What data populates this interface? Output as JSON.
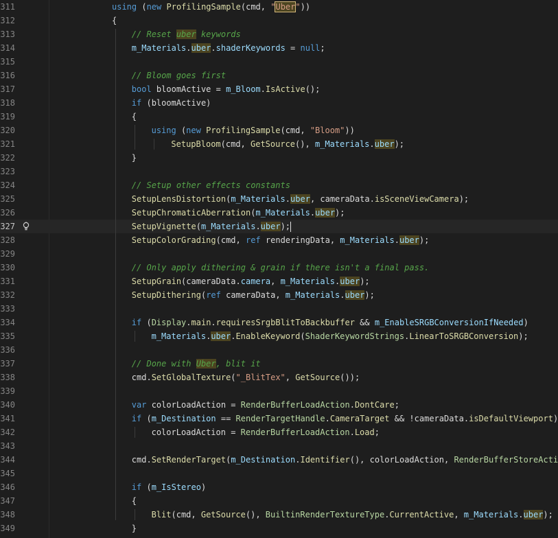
{
  "editor": {
    "current_line_number": "327",
    "search_highlight": "uber",
    "colors": {
      "background": "#1e1e1e",
      "keyword": "#569cd6",
      "type": "#4ec9b0",
      "method": "#dcdcaa",
      "string": "#d69d85",
      "comment": "#57a64a",
      "default": "#dcdcdc",
      "line_number": "#858585",
      "match_highlight": "#4c4420"
    },
    "lines": [
      {
        "n": "311",
        "indent": 0,
        "t": [
          [
            "k",
            "using"
          ],
          [
            "p",
            " ("
          ],
          [
            "k",
            "new"
          ],
          [
            "p",
            " "
          ],
          [
            "m",
            "ProfilingSample"
          ],
          [
            "p",
            "(cmd, "
          ],
          [
            "s",
            "\""
          ],
          [
            "sB",
            "Uber"
          ],
          [
            "s",
            "\""
          ],
          [
            "p",
            "))"
          ]
        ]
      },
      {
        "n": "312",
        "indent": 0,
        "t": [
          [
            "p",
            "{"
          ]
        ]
      },
      {
        "n": "313",
        "indent": 1,
        "t": [
          [
            "c",
            "// Reset "
          ],
          [
            "cH",
            "uber"
          ],
          [
            "c",
            " keywords"
          ]
        ]
      },
      {
        "n": "314",
        "indent": 1,
        "t": [
          [
            "f",
            "m_Materials"
          ],
          [
            "p",
            "."
          ],
          [
            "fH",
            "uber"
          ],
          [
            "p",
            "."
          ],
          [
            "f",
            "shaderKeywords"
          ],
          [
            "p",
            " = "
          ],
          [
            "k",
            "null"
          ],
          [
            "p",
            ";"
          ]
        ]
      },
      {
        "n": "315",
        "indent": 0,
        "t": []
      },
      {
        "n": "316",
        "indent": 1,
        "t": [
          [
            "c",
            "// Bloom goes first"
          ]
        ]
      },
      {
        "n": "317",
        "indent": 1,
        "t": [
          [
            "k",
            "bool"
          ],
          [
            "p",
            " bloomActive = "
          ],
          [
            "f",
            "m_Bloom"
          ],
          [
            "p",
            "."
          ],
          [
            "t",
            "IsActive"
          ],
          [
            "p",
            "();"
          ]
        ]
      },
      {
        "n": "318",
        "indent": 1,
        "t": [
          [
            "k",
            "if"
          ],
          [
            "p",
            " (bloomActive)"
          ]
        ]
      },
      {
        "n": "319",
        "indent": 1,
        "t": [
          [
            "p",
            "{"
          ]
        ]
      },
      {
        "n": "320",
        "indent": 2,
        "t": [
          [
            "k",
            "using"
          ],
          [
            "p",
            " ("
          ],
          [
            "k",
            "new"
          ],
          [
            "p",
            " "
          ],
          [
            "m",
            "ProfilingSample"
          ],
          [
            "p",
            "(cmd, "
          ],
          [
            "s",
            "\"Bloom\""
          ],
          [
            "p",
            "))"
          ]
        ]
      },
      {
        "n": "321",
        "indent": 3,
        "t": [
          [
            "m",
            "SetupBloom"
          ],
          [
            "p",
            "(cmd, "
          ],
          [
            "m",
            "GetSource"
          ],
          [
            "p",
            "(), "
          ],
          [
            "f",
            "m_Materials"
          ],
          [
            "p",
            "."
          ],
          [
            "fH",
            "uber"
          ],
          [
            "p",
            ");"
          ]
        ]
      },
      {
        "n": "322",
        "indent": 1,
        "t": [
          [
            "p",
            "}"
          ]
        ]
      },
      {
        "n": "323",
        "indent": 0,
        "t": []
      },
      {
        "n": "324",
        "indent": 1,
        "t": [
          [
            "c",
            "// Setup other effects constants"
          ]
        ]
      },
      {
        "n": "325",
        "indent": 1,
        "t": [
          [
            "m",
            "SetupLensDistortion"
          ],
          [
            "p",
            "("
          ],
          [
            "f",
            "m_Materials"
          ],
          [
            "p",
            "."
          ],
          [
            "fH",
            "uber"
          ],
          [
            "p",
            ", cameraData."
          ],
          [
            "t",
            "isSceneViewCamera"
          ],
          [
            "p",
            ");"
          ]
        ]
      },
      {
        "n": "326",
        "indent": 1,
        "t": [
          [
            "m",
            "SetupChromaticAberration"
          ],
          [
            "p",
            "("
          ],
          [
            "f",
            "m_Materials"
          ],
          [
            "p",
            "."
          ],
          [
            "fH",
            "uber"
          ],
          [
            "p",
            ");"
          ]
        ]
      },
      {
        "n": "327",
        "indent": 1,
        "t": [
          [
            "m",
            "SetupVignette"
          ],
          [
            "p",
            "("
          ],
          [
            "f",
            "m_Materials"
          ],
          [
            "p",
            "."
          ],
          [
            "fH",
            "uber"
          ],
          [
            "p",
            ");"
          ]
        ]
      },
      {
        "n": "328",
        "indent": 1,
        "t": [
          [
            "m",
            "SetupColorGrading"
          ],
          [
            "p",
            "(cmd, "
          ],
          [
            "k",
            "ref"
          ],
          [
            "p",
            " renderingData, "
          ],
          [
            "f",
            "m_Materials"
          ],
          [
            "p",
            "."
          ],
          [
            "fH",
            "uber"
          ],
          [
            "p",
            ");"
          ]
        ]
      },
      {
        "n": "329",
        "indent": 0,
        "t": []
      },
      {
        "n": "330",
        "indent": 1,
        "t": [
          [
            "c",
            "// Only apply dithering & grain if there isn't a final pass."
          ]
        ]
      },
      {
        "n": "331",
        "indent": 1,
        "t": [
          [
            "m",
            "SetupGrain"
          ],
          [
            "p",
            "(cameraData."
          ],
          [
            "f",
            "camera"
          ],
          [
            "p",
            ", "
          ],
          [
            "f",
            "m_Materials"
          ],
          [
            "p",
            "."
          ],
          [
            "fH",
            "uber"
          ],
          [
            "p",
            ");"
          ]
        ]
      },
      {
        "n": "332",
        "indent": 1,
        "t": [
          [
            "m",
            "SetupDithering"
          ],
          [
            "p",
            "("
          ],
          [
            "k",
            "ref"
          ],
          [
            "p",
            " cameraData, "
          ],
          [
            "f",
            "m_Materials"
          ],
          [
            "p",
            "."
          ],
          [
            "fH",
            "uber"
          ],
          [
            "p",
            ");"
          ]
        ]
      },
      {
        "n": "333",
        "indent": 0,
        "t": []
      },
      {
        "n": "334",
        "indent": 1,
        "t": [
          [
            "k",
            "if"
          ],
          [
            "p",
            " ("
          ],
          [
            "y",
            "Display"
          ],
          [
            "p",
            "."
          ],
          [
            "t",
            "main"
          ],
          [
            "p",
            "."
          ],
          [
            "t",
            "requiresSrgbBlitToBackbuffer"
          ],
          [
            "p",
            " && "
          ],
          [
            "f",
            "m_EnableSRGBConversionIfNeeded"
          ],
          [
            "p",
            ")"
          ]
        ]
      },
      {
        "n": "335",
        "indent": 2,
        "t": [
          [
            "f",
            "m_Materials"
          ],
          [
            "p",
            "."
          ],
          [
            "fH",
            "uber"
          ],
          [
            "p",
            "."
          ],
          [
            "m",
            "EnableKeyword"
          ],
          [
            "p",
            "("
          ],
          [
            "y",
            "ShaderKeywordStrings"
          ],
          [
            "p",
            "."
          ],
          [
            "t",
            "LinearToSRGBConversion"
          ],
          [
            "p",
            ");"
          ]
        ]
      },
      {
        "n": "336",
        "indent": 0,
        "t": []
      },
      {
        "n": "337",
        "indent": 1,
        "t": [
          [
            "c",
            "// Done with "
          ],
          [
            "cH",
            "Uber"
          ],
          [
            "c",
            ", blit it"
          ]
        ]
      },
      {
        "n": "338",
        "indent": 1,
        "t": [
          [
            "p",
            "cmd."
          ],
          [
            "m",
            "SetGlobalTexture"
          ],
          [
            "p",
            "("
          ],
          [
            "s",
            "\"_BlitTex\""
          ],
          [
            "p",
            ", "
          ],
          [
            "m",
            "GetSource"
          ],
          [
            "p",
            "());"
          ]
        ]
      },
      {
        "n": "339",
        "indent": 0,
        "t": []
      },
      {
        "n": "340",
        "indent": 1,
        "t": [
          [
            "k",
            "var"
          ],
          [
            "p",
            " colorLoadAction = "
          ],
          [
            "y",
            "RenderBufferLoadAction"
          ],
          [
            "p",
            "."
          ],
          [
            "t",
            "DontCare"
          ],
          [
            "p",
            ";"
          ]
        ]
      },
      {
        "n": "341",
        "indent": 1,
        "t": [
          [
            "k",
            "if"
          ],
          [
            "p",
            " ("
          ],
          [
            "f",
            "m_Destination"
          ],
          [
            "p",
            " == "
          ],
          [
            "y",
            "RenderTargetHandle"
          ],
          [
            "p",
            "."
          ],
          [
            "t",
            "CameraTarget"
          ],
          [
            "p",
            " && !cameraData."
          ],
          [
            "t",
            "isDefaultViewport"
          ],
          [
            "p",
            ")"
          ]
        ]
      },
      {
        "n": "342",
        "indent": 2,
        "t": [
          [
            "p",
            "colorLoadAction = "
          ],
          [
            "y",
            "RenderBufferLoadAction"
          ],
          [
            "p",
            "."
          ],
          [
            "t",
            "Load"
          ],
          [
            "p",
            ";"
          ]
        ]
      },
      {
        "n": "343",
        "indent": 0,
        "t": []
      },
      {
        "n": "344",
        "indent": 1,
        "t": [
          [
            "p",
            "cmd."
          ],
          [
            "m",
            "SetRenderTarget"
          ],
          [
            "p",
            "("
          ],
          [
            "f",
            "m_Destination"
          ],
          [
            "p",
            "."
          ],
          [
            "t",
            "Identifier"
          ],
          [
            "p",
            "(), colorLoadAction, "
          ],
          [
            "y",
            "RenderBufferStoreAction"
          ],
          [
            "p",
            "."
          ]
        ]
      },
      {
        "n": "345",
        "indent": 0,
        "t": []
      },
      {
        "n": "346",
        "indent": 1,
        "t": [
          [
            "k",
            "if"
          ],
          [
            "p",
            " ("
          ],
          [
            "f",
            "m_IsStereo"
          ],
          [
            "p",
            ")"
          ]
        ]
      },
      {
        "n": "347",
        "indent": 1,
        "t": [
          [
            "p",
            "{"
          ]
        ]
      },
      {
        "n": "348",
        "indent": 2,
        "t": [
          [
            "m",
            "Blit"
          ],
          [
            "p",
            "(cmd, "
          ],
          [
            "m",
            "GetSource"
          ],
          [
            "p",
            "(), "
          ],
          [
            "y",
            "BuiltinRenderTextureType"
          ],
          [
            "p",
            "."
          ],
          [
            "t",
            "CurrentActive"
          ],
          [
            "p",
            ", "
          ],
          [
            "f",
            "m_Materials"
          ],
          [
            "p",
            "."
          ],
          [
            "fH",
            "uber"
          ],
          [
            "p",
            ");"
          ]
        ]
      },
      {
        "n": "349",
        "indent": 1,
        "t": [
          [
            "p",
            "}"
          ]
        ]
      }
    ]
  }
}
